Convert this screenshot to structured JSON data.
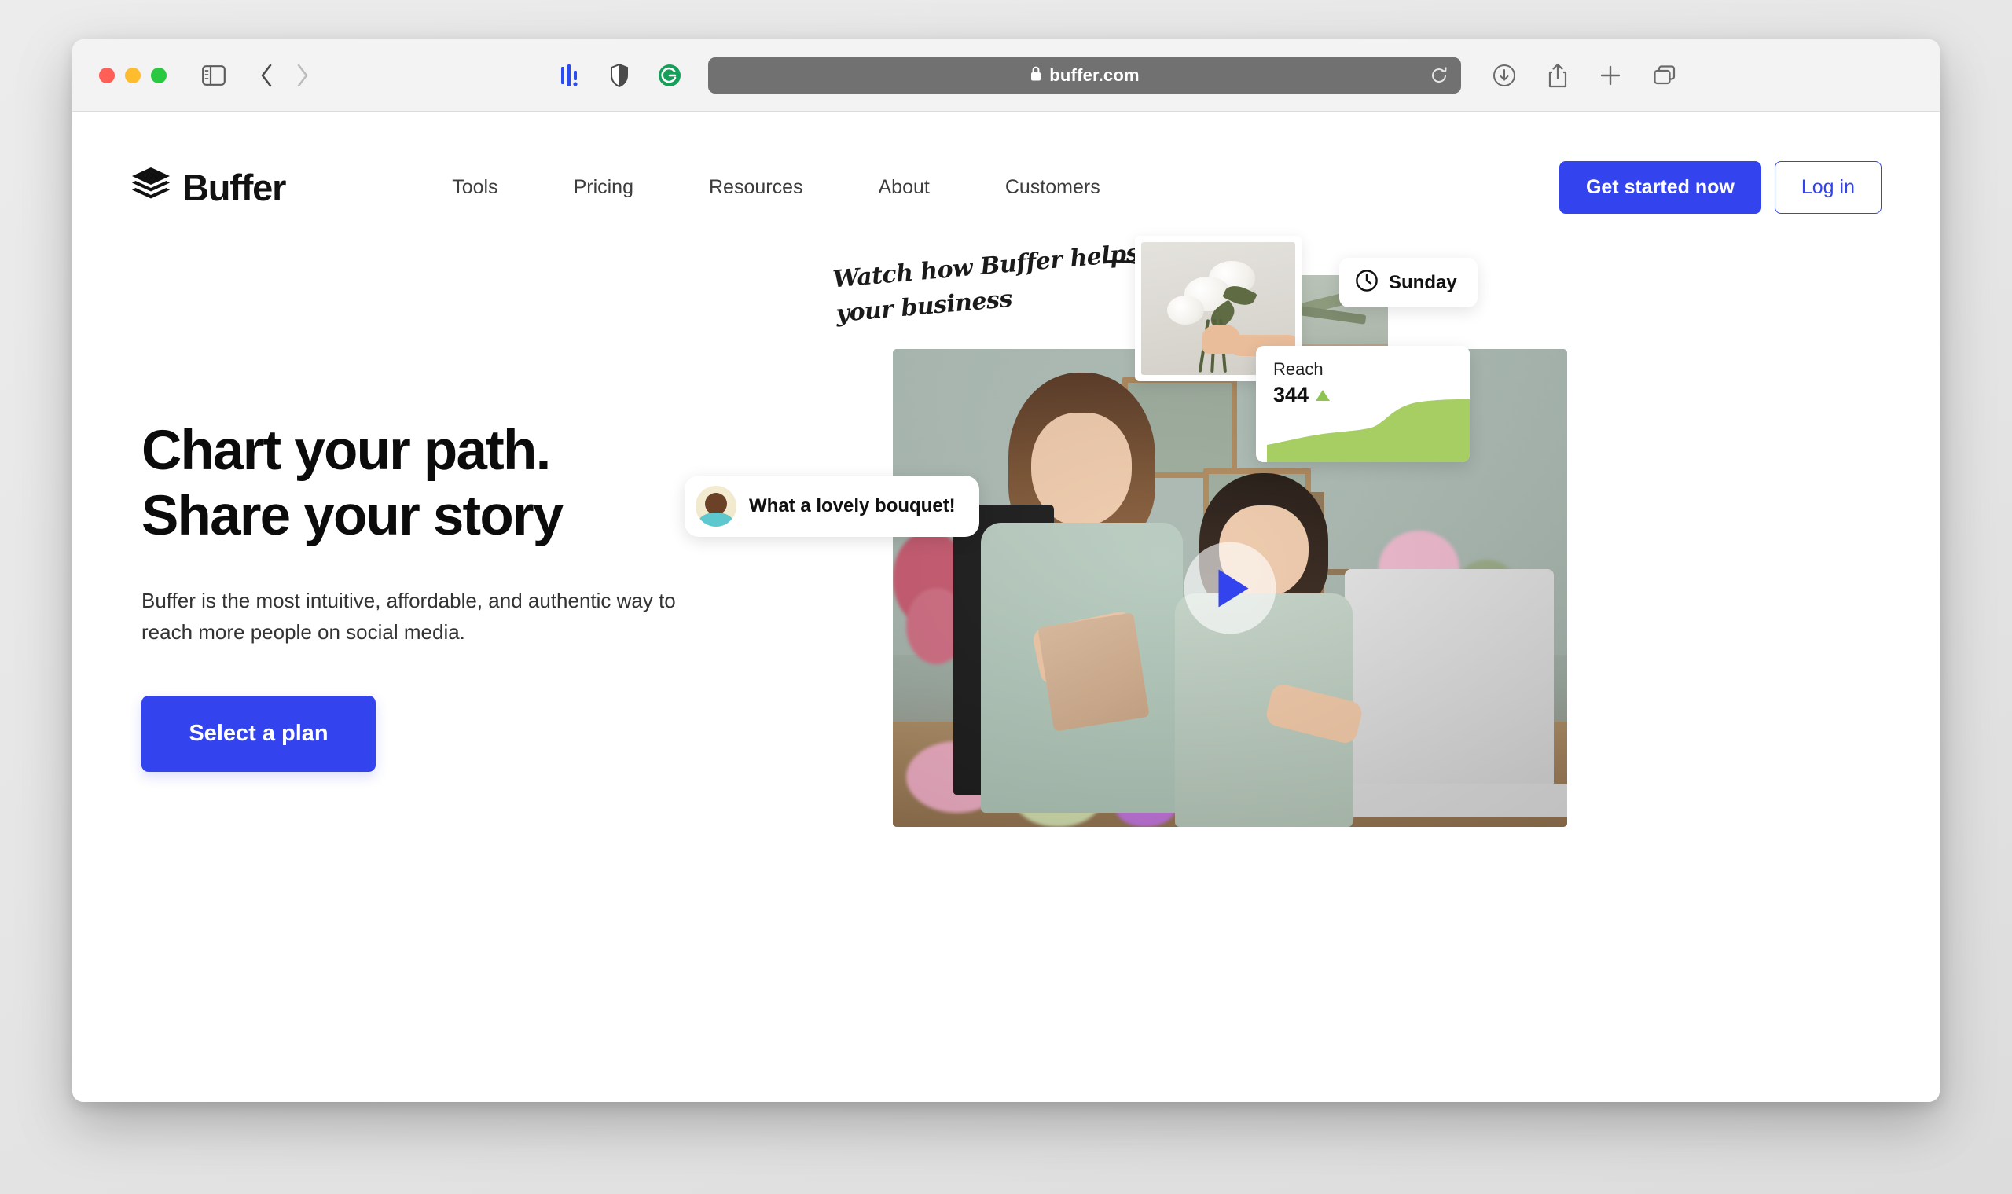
{
  "browser": {
    "url": "buffer.com",
    "lock_icon": "lock-icon",
    "reload_icon": "reload-icon",
    "sidebar_icon": "sidebar-toggle-icon",
    "back_icon": "back-chevron-icon",
    "forward_icon": "forward-chevron-icon",
    "extensions": [
      "grammarly-bars-icon",
      "shield-icon",
      "grammarly-icon"
    ],
    "right_actions": [
      "downloads-icon",
      "share-icon",
      "new-tab-icon",
      "tab-overview-icon"
    ],
    "traffic_lights": {
      "close": "#ff5f57",
      "minimize": "#febc2e",
      "maximize": "#28c840"
    }
  },
  "site": {
    "brand": {
      "name": "Buffer",
      "logo_icon": "buffer-stacked-layers-icon"
    },
    "nav": [
      {
        "label": "Tools"
      },
      {
        "label": "Pricing"
      },
      {
        "label": "Resources"
      },
      {
        "label": "About"
      },
      {
        "label": "Customers"
      }
    ],
    "header_ctas": {
      "primary": "Get started now",
      "secondary": "Log in"
    },
    "hero": {
      "title_line1": "Chart your path.",
      "title_line2": "Share your story",
      "subtitle": "Buffer is the most intuitive, affordable, and authentic way to reach more people on social media.",
      "cta": "Select a plan",
      "annotation": "Watch how Buffer helps your business",
      "annotation_arrow_icon": "curved-arrow-icon",
      "play_icon": "play-icon"
    },
    "floating_cards": {
      "schedule": {
        "label": "Sunday",
        "icon": "clock-icon"
      },
      "reach": {
        "title": "Reach",
        "value": "344",
        "trend_icon": "triangle-up-icon",
        "trend_color": "#8ec44f"
      },
      "comment": {
        "text": "What a lovely bouquet!",
        "avatar_icon": "user-avatar"
      }
    },
    "colors": {
      "brand_blue": "#3344ee",
      "chart_green": "#a6ce63",
      "text_dark": "#0b0b0b"
    }
  },
  "chart_data": {
    "type": "area",
    "title": "Reach",
    "value_label": "344",
    "x": [
      0,
      1,
      2,
      3,
      4,
      5,
      6,
      7,
      8
    ],
    "values": [
      22,
      30,
      36,
      40,
      42,
      46,
      68,
      84,
      88
    ],
    "ylim": [
      0,
      100
    ],
    "color": "#a6ce63",
    "grid": false,
    "legend": "none"
  }
}
